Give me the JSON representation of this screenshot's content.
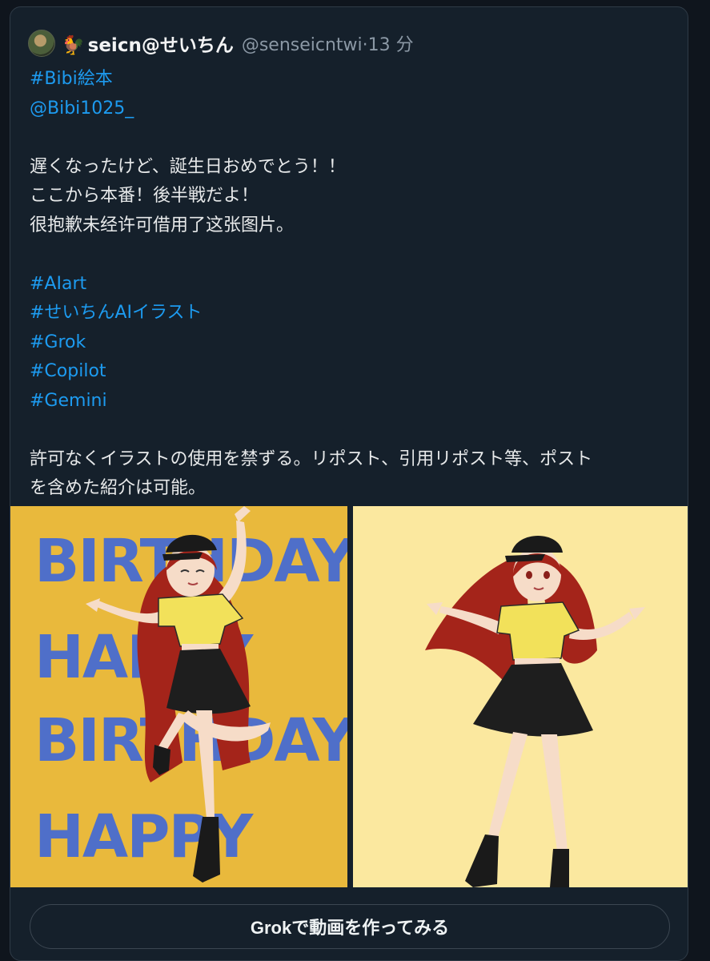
{
  "post": {
    "display_name": "seicn@せいちん",
    "name_emoji": "🐓",
    "handle": "@senseicntwi",
    "separator": "·",
    "time": "13 分",
    "lines": [
      {
        "text": "#Bibi絵本",
        "type": "link"
      },
      {
        "text": "@Bibi1025_",
        "type": "link"
      },
      {
        "text": "",
        "type": "blank"
      },
      {
        "text": "遅くなったけど、誕生日おめでとう！！",
        "type": "plain"
      },
      {
        "text": "ここから本番！後半戦だよ！",
        "type": "plain"
      },
      {
        "text": "很抱歉未经许可借用了这张图片。",
        "type": "plain"
      },
      {
        "text": "",
        "type": "blank"
      },
      {
        "text": "#AIart",
        "type": "link"
      },
      {
        "text": "#せいちんAIイラスト",
        "type": "link"
      },
      {
        "text": "#Grok",
        "type": "link"
      },
      {
        "text": "#Copilot",
        "type": "link"
      },
      {
        "text": "#Gemini",
        "type": "link"
      },
      {
        "text": "",
        "type": "blank"
      },
      {
        "text": "許可なくイラストの使用を禁ずる。リポスト、引用リポスト等、ポスト",
        "type": "plain"
      },
      {
        "text": "を含めた紹介は可能。",
        "type": "plain"
      }
    ],
    "image_left": {
      "background_words": [
        "HAPPY",
        "BIRTHDAY",
        "HAPPY",
        "BIRTHDAY",
        "HAPPY",
        "BIRTHDAY"
      ]
    }
  },
  "grok_button": {
    "label": "Grokで動画を作ってみる"
  },
  "colors": {
    "background": "#15202b",
    "link": "#1d9bf0",
    "text": "#e7e9ea",
    "muted": "#8b98a5",
    "left_image_bg": "#e9b93c",
    "right_image_bg": "#fbe89f"
  }
}
